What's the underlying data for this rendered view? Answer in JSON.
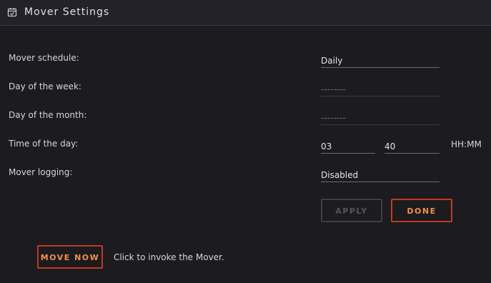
{
  "header": {
    "title": "Mover Settings",
    "icon": "calendar-icon"
  },
  "form": {
    "schedule": {
      "label": "Mover schedule:",
      "value": "Daily"
    },
    "day_of_week": {
      "label": "Day of the week:",
      "value": "--------"
    },
    "day_of_month": {
      "label": "Day of the month:",
      "value": "--------"
    },
    "time_of_day": {
      "label": "Time of the day:",
      "hour": "03",
      "minute": "40",
      "format": "HH:MM"
    },
    "logging": {
      "label": "Mover logging:",
      "value": "Disabled"
    }
  },
  "buttons": {
    "apply": "APPLY",
    "done": "DONE",
    "move_now": "MOVE NOW"
  },
  "move_now_description": "Click to invoke the Mover.",
  "colors": {
    "accent": "#f0924a",
    "accent_border": "#c03a1e",
    "background": "#1c1b20"
  }
}
